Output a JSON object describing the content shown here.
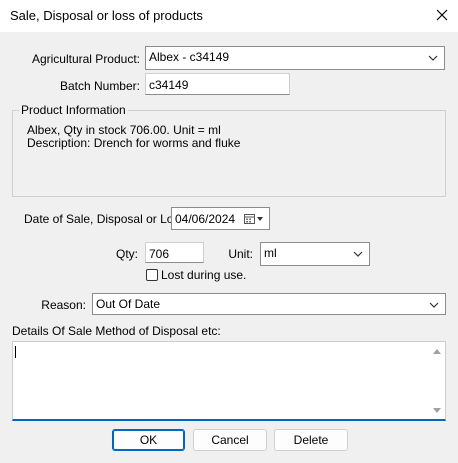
{
  "window": {
    "title": "Sale, Disposal or loss of products"
  },
  "fields": {
    "product_label": "Agricultural Product:",
    "product_value": "Albex - c34149",
    "batch_label": "Batch Number:",
    "batch_value": "c34149",
    "info_group_label": "Product Information",
    "info_line1": "Albex, Qty in stock 706.00. Unit = ml",
    "info_line2": "Description: Drench for worms and fluke",
    "date_label": "Date of Sale, Disposal or Loss:",
    "date_value": "04/06/2024",
    "qty_label": "Qty:",
    "qty_value": "706",
    "unit_label": "Unit:",
    "unit_value": "ml",
    "lost_label": "Lost during use.",
    "reason_label": "Reason:",
    "reason_value": "Out Of Date",
    "details_label": "Details Of Sale Method of Disposal etc:",
    "details_value": ""
  },
  "buttons": {
    "ok": "OK",
    "cancel": "Cancel",
    "delete": "Delete"
  },
  "colors": {
    "accent": "#0067c0",
    "background": "#f0f0f0"
  }
}
